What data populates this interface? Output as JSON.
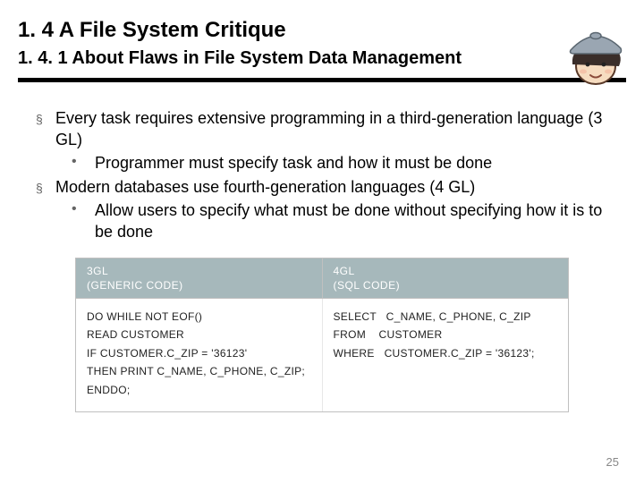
{
  "title": "1. 4 A File System Critique",
  "subtitle": "1. 4. 1 About Flaws in File System Data Management",
  "bullets": [
    {
      "level": 1,
      "text": "Every task requires extensive programming in a third-generation language (3 GL)"
    },
    {
      "level": 2,
      "text": "Programmer must specify task and how it must be done"
    },
    {
      "level": 1,
      "text": "Modern databases use fourth-generation languages (4 GL)"
    },
    {
      "level": 2,
      "text": "Allow users to specify what must be done without specifying how it is to be done"
    }
  ],
  "figure": {
    "headers": [
      {
        "line1": "3GL",
        "line2": "(GENERIC CODE)"
      },
      {
        "line1": "4GL",
        "line2": "(SQL CODE)"
      }
    ],
    "code_left": "DO WHILE NOT EOF()\nREAD CUSTOMER\nIF CUSTOMER.C_ZIP = '36123'\nTHEN PRINT C_NAME, C_PHONE, C_ZIP;\nENDDO;",
    "code_right": "SELECT   C_NAME, C_PHONE, C_ZIP\nFROM    CUSTOMER\nWHERE   CUSTOMER.C_ZIP = '36123';"
  },
  "page_number": "25",
  "symbols": {
    "bullet_l1": "§",
    "bullet_l2": "•"
  }
}
